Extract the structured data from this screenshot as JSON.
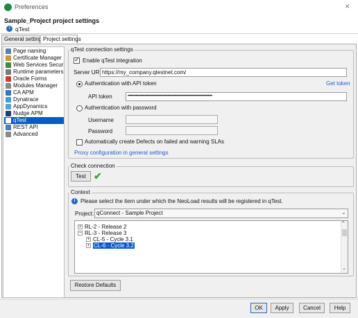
{
  "window": {
    "title": "Preferences",
    "close_glyph": "×"
  },
  "header": {
    "title": "Sample_Project project settings",
    "subtitle": "qTest"
  },
  "tabs": [
    {
      "label": "General settings"
    },
    {
      "label": "Project settings"
    }
  ],
  "sidebar": {
    "items": [
      {
        "label": "Page naming",
        "icon": "page-icon",
        "color": "#5a7fb5"
      },
      {
        "label": "Certificate Manager",
        "icon": "certificate-icon",
        "color": "#c99a2e"
      },
      {
        "label": "Web Services Security",
        "icon": "web-services-icon",
        "color": "#3d8b3d"
      },
      {
        "label": "Runtime parameters",
        "icon": "runtime-icon",
        "color": "#7a7a7a"
      },
      {
        "label": "Oracle Forms",
        "icon": "oracle-icon",
        "color": "#d23c2c"
      },
      {
        "label": "Modules Manager",
        "icon": "modules-icon",
        "color": "#8a8a8a"
      },
      {
        "label": "CA APM",
        "icon": "ca-apm-icon",
        "color": "#2e7ab8"
      },
      {
        "label": "Dynatrace",
        "icon": "dynatrace-icon",
        "color": "#3fa0d8"
      },
      {
        "label": "AppDynamics",
        "icon": "appdynamics-icon",
        "color": "#5aa0d0"
      },
      {
        "label": "Nudge APM",
        "icon": "nudge-icon",
        "color": "#1c3f7a"
      },
      {
        "label": "qTest",
        "icon": "qtest-icon",
        "color": "#ffffff"
      },
      {
        "label": "REST API",
        "icon": "rest-api-icon",
        "color": "#4a7ac0"
      },
      {
        "label": "Advanced",
        "icon": "gear-icon",
        "color": "#888888"
      }
    ],
    "selected_index": 10
  },
  "connection": {
    "legend": "qTest connection settings",
    "enable_label": "Enable qTest integration",
    "enable_checked": true,
    "server_url_label": "Server URL",
    "server_url_value": "https://my_company.qtestnet.com/",
    "auth_token_label": "Authentication with API token",
    "get_token_label": "Get token",
    "api_token_label": "API token",
    "api_token_value": "••••••••••••••••••••••••••••••••••••••••••••••••••••••••••••••••••••••••••••",
    "auth_password_label": "Authentication with password",
    "username_label": "Username",
    "password_label": "Password",
    "auto_defects_label": "Automatically create Defects on failed and warning SLAs",
    "auto_defects_checked": false,
    "proxy_link": "Proxy configuration in general settings"
  },
  "check_connection": {
    "legend": "Check connection",
    "test_label": "Test",
    "status_icon": "check-icon"
  },
  "context": {
    "legend": "Context",
    "info_text": "Please select the item under which the NeoLoad results will be registered in qTest.",
    "project_label": "Project:",
    "project_value": "qConnect - Sample Project",
    "tree": [
      {
        "label": "RL-2 - Release 2",
        "level": 0,
        "expander": "+",
        "selected": false
      },
      {
        "label": "RL-3 - Release 3",
        "level": 0,
        "expander": "−",
        "selected": false
      },
      {
        "label": "CL-5 - Cycle 3.1",
        "level": 1,
        "expander": "+",
        "selected": false
      },
      {
        "label": "CL-6 - Cycle 3.2",
        "level": 1,
        "expander": "+",
        "selected": true
      }
    ]
  },
  "restore_defaults_label": "Restore Defaults",
  "footer": {
    "ok": "OK",
    "apply": "Apply",
    "cancel": "Cancel",
    "help": "Help"
  }
}
